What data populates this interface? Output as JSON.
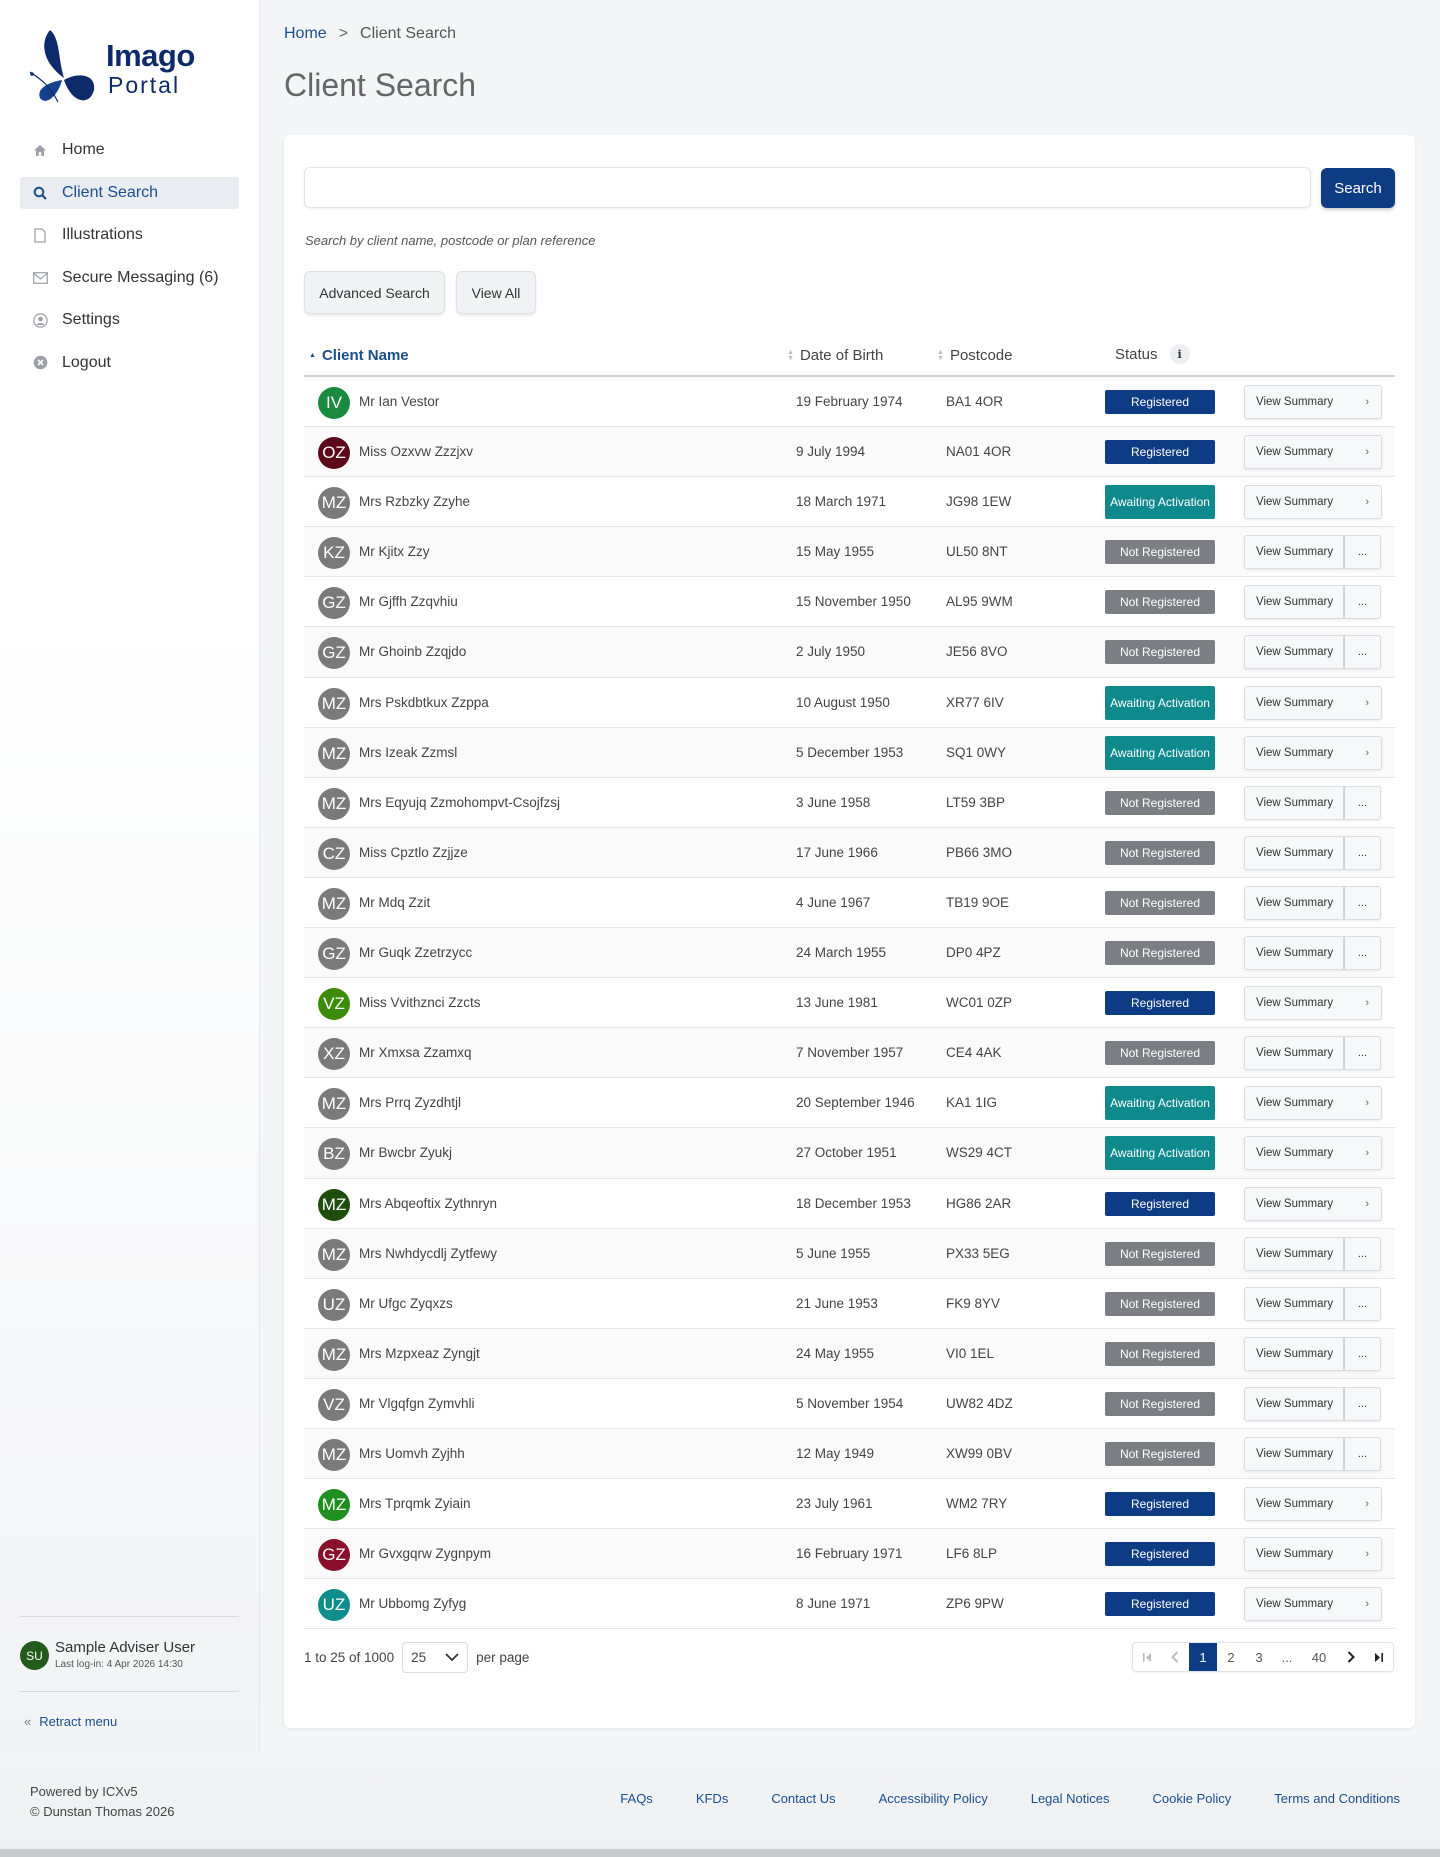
{
  "brand": {
    "name_line1": "Imago",
    "name_line2": "Portal",
    "color": "#0d2b6b"
  },
  "nav": [
    {
      "label": "Home",
      "icon": "home-icon",
      "active": false
    },
    {
      "label": "Client Search",
      "icon": "search-icon",
      "active": true
    },
    {
      "label": "Illustrations",
      "icon": "document-icon",
      "active": false
    },
    {
      "label": "Secure Messaging (6)",
      "icon": "mail-icon",
      "active": false
    },
    {
      "label": "Settings",
      "icon": "user-circle-icon",
      "active": false
    },
    {
      "label": "Logout",
      "icon": "close-circle-icon",
      "active": false
    }
  ],
  "user": {
    "initials": "SU",
    "name": "Sample Adviser User",
    "last_login": "Last log-in: 4 Apr 2026 14:30"
  },
  "retract_label": "Retract menu",
  "breadcrumb": {
    "home": "Home",
    "separator": ">",
    "current": "Client Search"
  },
  "page_title": "Client Search",
  "search": {
    "value": "",
    "placeholder": "",
    "button": "Search",
    "hint": "Search by client name, postcode or plan reference"
  },
  "buttons": {
    "advanced": "Advanced Search",
    "view_all": "View All"
  },
  "table": {
    "headers": {
      "name": "Client Name",
      "dob": "Date of Birth",
      "postcode": "Postcode",
      "status": "Status"
    },
    "action_label": "View Summary",
    "more_label": "...",
    "rows": [
      {
        "initials": "IV",
        "color": "#1a8a3e",
        "name": "Mr Ian Vestor",
        "dob": "19 February 1974",
        "postcode": "BA1 4OR",
        "status": "Registered"
      },
      {
        "initials": "OZ",
        "color": "#5c0a1a",
        "name": "Miss Ozxvw Zzzjxv",
        "dob": "9 July 1994",
        "postcode": "NA01 4OR",
        "status": "Registered"
      },
      {
        "initials": "MZ",
        "color": "#7a7a7a",
        "name": "Mrs Rzbzky Zzyhe",
        "dob": "18 March 1971",
        "postcode": "JG98 1EW",
        "status": "Awaiting Activation"
      },
      {
        "initials": "KZ",
        "color": "#7a7a7a",
        "name": "Mr Kjitx Zzy",
        "dob": "15 May 1955",
        "postcode": "UL50 8NT",
        "status": "Not Registered"
      },
      {
        "initials": "GZ",
        "color": "#7a7a7a",
        "name": "Mr Gjffh Zzqvhiu",
        "dob": "15 November 1950",
        "postcode": "AL95 9WM",
        "status": "Not Registered"
      },
      {
        "initials": "GZ",
        "color": "#7a7a7a",
        "name": "Mr Ghoinb Zzqjdo",
        "dob": "2 July 1950",
        "postcode": "JE56 8VO",
        "status": "Not Registered"
      },
      {
        "initials": "MZ",
        "color": "#7a7a7a",
        "name": "Mrs Pskdbtkux Zzppa",
        "dob": "10 August 1950",
        "postcode": "XR77 6IV",
        "status": "Awaiting Activation"
      },
      {
        "initials": "MZ",
        "color": "#7a7a7a",
        "name": "Mrs Izeak Zzmsl",
        "dob": "5 December 1953",
        "postcode": "SQ1 0WY",
        "status": "Awaiting Activation"
      },
      {
        "initials": "MZ",
        "color": "#7a7a7a",
        "name": "Mrs Eqyujq Zzmohompvt-Csojfzsj",
        "dob": "3 June 1958",
        "postcode": "LT59 3BP",
        "status": "Not Registered"
      },
      {
        "initials": "CZ",
        "color": "#7a7a7a",
        "name": "Miss Cpztlo Zzjjze",
        "dob": "17 June 1966",
        "postcode": "PB66 3MO",
        "status": "Not Registered"
      },
      {
        "initials": "MZ",
        "color": "#7a7a7a",
        "name": "Mr Mdq Zzit",
        "dob": "4 June 1967",
        "postcode": "TB19 9OE",
        "status": "Not Registered"
      },
      {
        "initials": "GZ",
        "color": "#7a7a7a",
        "name": "Mr Guqk Zzetrzycc",
        "dob": "24 March 1955",
        "postcode": "DP0 4PZ",
        "status": "Not Registered"
      },
      {
        "initials": "VZ",
        "color": "#3c8c0c",
        "name": "Miss Vvithznci Zzcts",
        "dob": "13 June 1981",
        "postcode": "WC01 0ZP",
        "status": "Registered"
      },
      {
        "initials": "XZ",
        "color": "#7a7a7a",
        "name": "Mr Xmxsa Zzamxq",
        "dob": "7 November 1957",
        "postcode": "CE4 4AK",
        "status": "Not Registered"
      },
      {
        "initials": "MZ",
        "color": "#7a7a7a",
        "name": "Mrs Prrq Zyzdhtjl",
        "dob": "20 September 1946",
        "postcode": "KA1 1IG",
        "status": "Awaiting Activation"
      },
      {
        "initials": "BZ",
        "color": "#7a7a7a",
        "name": "Mr Bwcbr Zyukj",
        "dob": "27 October 1951",
        "postcode": "WS29 4CT",
        "status": "Awaiting Activation"
      },
      {
        "initials": "MZ",
        "color": "#1f4e0c",
        "name": "Mrs Abqeoftix Zythnryn",
        "dob": "18 December 1953",
        "postcode": "HG86 2AR",
        "status": "Registered"
      },
      {
        "initials": "MZ",
        "color": "#7a7a7a",
        "name": "Mrs Nwhdycdlj Zytfewy",
        "dob": "5 June 1955",
        "postcode": "PX33 5EG",
        "status": "Not Registered"
      },
      {
        "initials": "UZ",
        "color": "#7a7a7a",
        "name": "Mr Ufgc Zyqxzs",
        "dob": "21 June 1953",
        "postcode": "FK9 8YV",
        "status": "Not Registered"
      },
      {
        "initials": "MZ",
        "color": "#7a7a7a",
        "name": "Mrs Mzpxeaz Zyngjt",
        "dob": "24 May 1955",
        "postcode": "VI0 1EL",
        "status": "Not Registered"
      },
      {
        "initials": "VZ",
        "color": "#7a7a7a",
        "name": "Mr Vlgqfgn Zymvhli",
        "dob": "5 November 1954",
        "postcode": "UW82 4DZ",
        "status": "Not Registered"
      },
      {
        "initials": "MZ",
        "color": "#7a7a7a",
        "name": "Mrs Uomvh Zyjhh",
        "dob": "12 May 1949",
        "postcode": "XW99 0BV",
        "status": "Not Registered"
      },
      {
        "initials": "MZ",
        "color": "#1f8f1f",
        "name": "Mrs Tprqmk Zyiain",
        "dob": "23 July 1961",
        "postcode": "WM2 7RY",
        "status": "Registered"
      },
      {
        "initials": "GZ",
        "color": "#8a0f2c",
        "name": "Mr Gvxgqrw Zygnpym",
        "dob": "16 February 1971",
        "postcode": "LF6 8LP",
        "status": "Registered"
      },
      {
        "initials": "UZ",
        "color": "#0f8c8c",
        "name": "Mr Ubbomg Zyfyg",
        "dob": "8 June 1971",
        "postcode": "ZP6 9PW",
        "status": "Registered"
      }
    ]
  },
  "status_colors": {
    "Registered": "#0d3b84",
    "Awaiting Activation": "#0e8a8c",
    "Not Registered": "#7b7f84"
  },
  "pagination": {
    "range": "1 to 25 of 1000",
    "page_size": "25",
    "per_page": "per page",
    "pages": [
      "1",
      "2",
      "3",
      "...",
      "40"
    ],
    "current": "1"
  },
  "footer": {
    "powered": "Powered by ICXv5",
    "copyright": "© Dunstan Thomas 2026",
    "links": [
      "FAQs",
      "KFDs",
      "Contact Us",
      "Accessibility Policy",
      "Legal Notices",
      "Cookie Policy",
      "Terms and Conditions"
    ]
  }
}
